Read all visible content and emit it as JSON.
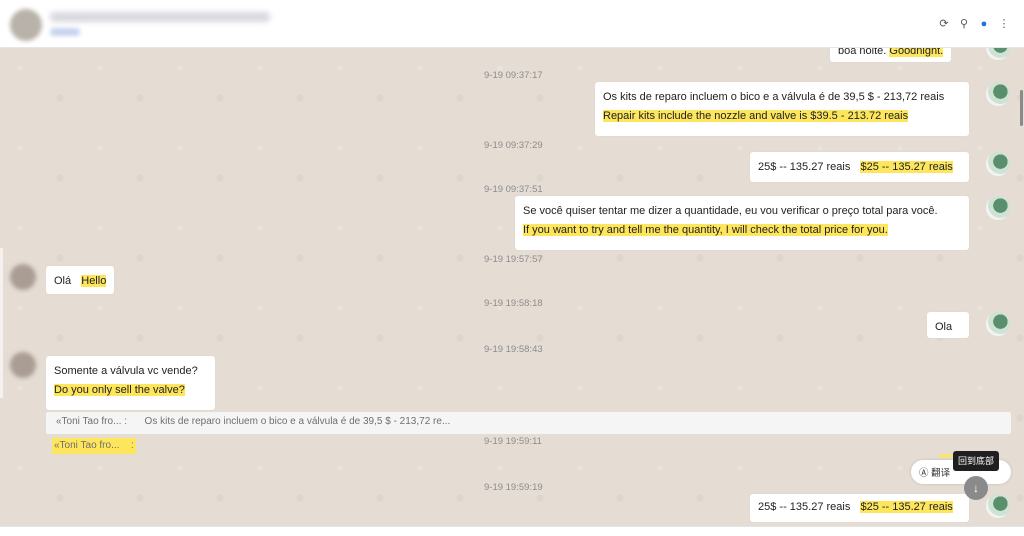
{
  "header": {
    "contact_name": "",
    "contact_sub": ""
  },
  "messages": {
    "top_partial": {
      "text": "boa noite.",
      "translation": "Goodnight."
    },
    "ts1": "9-19 09:37:17",
    "m1": {
      "text": "Os kits de reparo incluem o bico e a válvula é de 39,5 $ - 213,72 reais",
      "translation": "Repair kits include the nozzle and valve is $39.5 - 213.72 reais"
    },
    "ts2": "9-19 09:37:29",
    "m2": {
      "text": "25$ -- 135.27 reais",
      "translation": "$25 -- 135.27 reais"
    },
    "ts3": "9-19 09:37:51",
    "m3": {
      "text": "Se você quiser tentar me dizer a quantidade, eu vou verificar o preço total para você.",
      "translation": "If you want to try and tell me the quantity, I will check the total price for you."
    },
    "ts4": "9-19 19:57:57",
    "m4": {
      "text": "Olá",
      "translation": "Hello"
    },
    "ts5": "9-19 19:58:18",
    "m5": {
      "text": "Ola"
    },
    "ts6": "9-19 19:58:43",
    "m6": {
      "text": "Somente a válvula vc vende?",
      "translation": "Do you only sell the valve?"
    },
    "quote": {
      "sender": "«Toni Tao fro...",
      "colon": ":",
      "text": "Os kits de reparo incluem o bico e a válvula é de 39,5 $ - 213,72 re..."
    },
    "quote_translation": {
      "sender": "«Toni Tao fro...",
      "colon": ":"
    },
    "ts7": "9-19 19:59:11",
    "ts8": "9-19 19:59:19",
    "m8": {
      "text": "25$ -- 135.27 reais",
      "translation": "$25 -- 135.27 reais"
    }
  },
  "overlay": {
    "tooltip": "回到底部",
    "translate_label": "翻译",
    "translate_icon": "translate-icon",
    "scroll_down_icon": "arrow-down-icon"
  },
  "colors": {
    "highlight": "#fde55c",
    "chat_bg": "#e5ddd4",
    "bubble": "#ffffff",
    "accent": "#1e6ee8"
  }
}
